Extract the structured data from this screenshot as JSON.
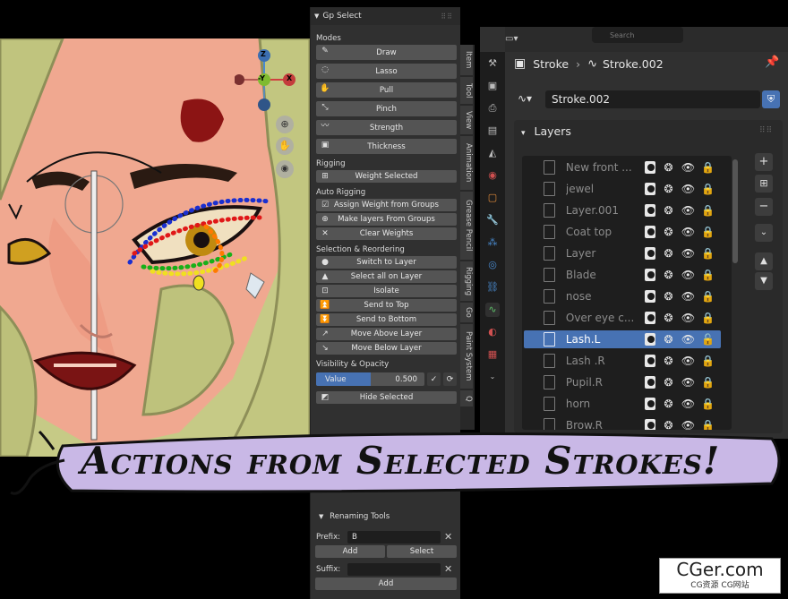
{
  "gp_panel": {
    "title": "Gp Select",
    "modes_label": "Modes",
    "modes": [
      "Draw",
      "Lasso",
      "Pull",
      "Pinch",
      "Strength",
      "Thickness"
    ],
    "rigging_label": "Rigging",
    "rigging": [
      "Weight Selected"
    ],
    "auto_rigging_label": "Auto Rigging",
    "auto_rigging": [
      "Assign Weight from Groups",
      "Make layers From Groups",
      "Clear Weights"
    ],
    "selection_label": "Selection & Reordering",
    "selection": [
      "Switch to Layer",
      "Select all on Layer",
      "Isolate",
      "Send to Top",
      "Send to Bottom",
      "Move Above Layer",
      "Move Below Layer"
    ],
    "visibility_label": "Visibility & Opacity",
    "value_label": "Value",
    "value": "0.500",
    "value_fraction": 0.5,
    "hide_selected": "Hide Selected"
  },
  "side_tabs": [
    "Item",
    "Tool",
    "View",
    "Animation",
    "Grease Pencil",
    "Rigging",
    "Go",
    "Paint System",
    "Q"
  ],
  "renaming": {
    "title": "Renaming Tools",
    "prefix_label": "Prefix:",
    "prefix_value": "B",
    "add_label": "Add",
    "select_label": "Select",
    "suffix_label": "Suffix:",
    "suffix_value": "",
    "suffix_add_label": "Add"
  },
  "properties": {
    "search_placeholder": "Search",
    "breadcrumb_object": "Stroke",
    "breadcrumb_data": "Stroke.002",
    "data_name": "Stroke.002",
    "layers_title": "Layers",
    "layers": [
      {
        "name": "New front ...",
        "active": false
      },
      {
        "name": "jewel",
        "active": false
      },
      {
        "name": "Layer.001",
        "active": false
      },
      {
        "name": "Coat top",
        "active": false
      },
      {
        "name": "Layer",
        "active": false
      },
      {
        "name": "Blade",
        "active": false
      },
      {
        "name": "nose",
        "active": false
      },
      {
        "name": "Over eye c...",
        "active": false
      },
      {
        "name": "Lash.L",
        "active": true
      },
      {
        "name": "Lash .R",
        "active": false
      },
      {
        "name": "Pupil.R",
        "active": false
      },
      {
        "name": "horn",
        "active": false
      },
      {
        "name": "Brow.R",
        "active": false
      }
    ]
  },
  "gizmo": {
    "z": "Z",
    "y": "-Y",
    "x": "X"
  },
  "banner": "Actions from Selected Strokes!",
  "watermark": {
    "main": "CGer.com",
    "sub": "CG资源 CG网站"
  },
  "colors": {
    "accent": "#4772b3",
    "panel": "#303030",
    "button": "#545454",
    "banner": "#c9b8e6"
  }
}
